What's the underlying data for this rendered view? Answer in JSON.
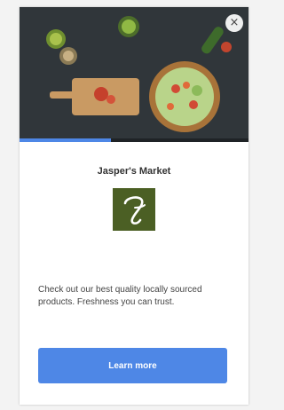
{
  "ad": {
    "title": "Jasper's Market",
    "description": "Check out our best quality locally sourced products. Freshness you can trust.",
    "cta_label": "Learn more",
    "close_icon": "×",
    "progress": 0.4
  },
  "colors": {
    "accent": "#4e87e6",
    "logo_bg": "#4b5f24"
  },
  "hero_image": {
    "description_icon": "food-photo"
  }
}
